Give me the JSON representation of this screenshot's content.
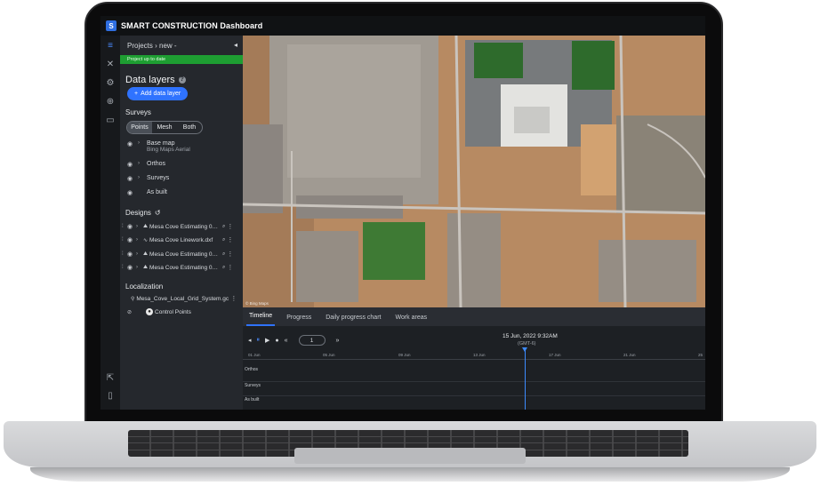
{
  "app": {
    "title": "SMART CONSTRUCTION Dashboard",
    "logo_icon": "app-logo-icon"
  },
  "sidebar": {
    "project_selector": "Projects › new -",
    "status": "Project up to date",
    "data_layers_title": "Data layers",
    "add_data_layer": "Add data layer",
    "surveys_label": "Surveys",
    "mode_options": [
      "Points",
      "Mesh",
      "Both"
    ],
    "mode_selected": "Points",
    "layers": [
      {
        "name": "Base map",
        "sub": "Bing Maps Aerial"
      },
      {
        "name": "Orthos"
      },
      {
        "name": "Surveys"
      },
      {
        "name": "As built"
      }
    ],
    "designs_label": "Designs",
    "designs": [
      "Mesa Cove Estimating 051...",
      "Mesa Cove Linework.dxf",
      "Mesa Cove Estimating 051...",
      "Mesa Cove Estimating 051..."
    ],
    "localization_label": "Localization",
    "localization_file": "Mesa_Cove_Local_Grid_System.gc3",
    "control_points": "Control Points"
  },
  "bottom_tabs": [
    "Timeline",
    "Progress",
    "Daily progress chart",
    "Work areas"
  ],
  "active_tab": "Timeline",
  "timeline": {
    "step_value": "1",
    "current_date": "15 Jun, 2022 9:32AM",
    "timezone": "(GMT-6)",
    "ticks": [
      "01 Jun",
      "05 Jun",
      "09 Jun",
      "13 Jun",
      "17 Jun",
      "21 Jun",
      "25"
    ],
    "rows": [
      "Orthos",
      "Surveys",
      "As built"
    ]
  },
  "map": {
    "attribution": "© Bing Maps"
  },
  "colors": {
    "accent": "#2f73ff",
    "status_green": "#1e9e32",
    "panel": "#25282d"
  }
}
